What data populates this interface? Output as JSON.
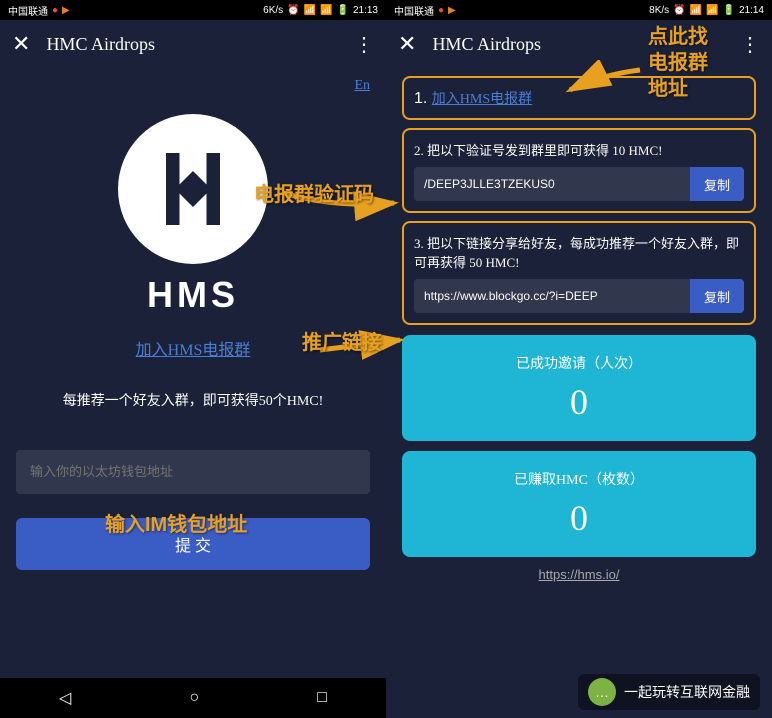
{
  "left": {
    "status": {
      "carrier": "中国联通",
      "speed": "6K/s",
      "time": "21:13"
    },
    "header": {
      "title": "HMC Airdrops"
    },
    "lang": "En",
    "logo_text": "HMS",
    "telegram_link": "加入HMS电报群",
    "promo": "每推荐一个好友入群，即可获得50个HMC!",
    "input_placeholder": "输入你的以太坊钱包地址",
    "submit": "提 交"
  },
  "right": {
    "status": {
      "carrier": "中国联通",
      "speed": "8K/s",
      "time": "21:14"
    },
    "header": {
      "title": "HMC Airdrops"
    },
    "step1": {
      "label": "1.",
      "link": "加入HMS电报群"
    },
    "step2": {
      "label": "2. 把以下验证号发到群里即可获得 10 HMC!",
      "code": "/DEEP3JLLE3TZEKUS0",
      "copy": "复制"
    },
    "step3": {
      "label": "3. 把以下链接分享给好友，每成功推荐一个好友入群，即可再获得 50 HMC!",
      "url": "https://www.blockgo.cc/?i=DEEP",
      "copy": "复制"
    },
    "stat1": {
      "label": "已成功邀请（人次）",
      "value": "0"
    },
    "stat2": {
      "label": "已赚取HMC（枚数）",
      "value": "0"
    },
    "footer": "https://hms.io/"
  },
  "annotations": {
    "a1": "电报群验证码",
    "a2": "推广链接",
    "a3": "输入IM钱包地址",
    "a4": "点此找\n电报群\n地址"
  },
  "watermark": "一起玩转互联网金融"
}
